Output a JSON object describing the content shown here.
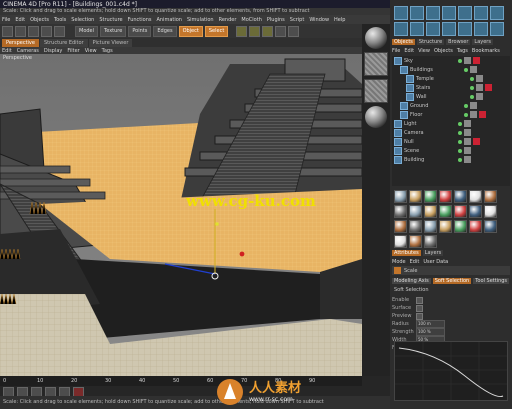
{
  "app": {
    "title": "CINEMA 4D [Pro R11] - [Buildings_001.c4d *]",
    "hint_top": "Scale: Click and drag to scale elements; hold down SHIFT to quantize scale; add to other elements, from SHIFT to subtract"
  },
  "menu": [
    "File",
    "Edit",
    "Objects",
    "Tools",
    "Selection",
    "Structure",
    "Functions",
    "Animation",
    "Simulation",
    "Render",
    "MoCloth",
    "Plugins",
    "Script",
    "Window",
    "Help"
  ],
  "toolbar": {
    "buttons": [
      "Model",
      "Texture",
      "Points",
      "Edges",
      "Object",
      "Select"
    ],
    "active": [
      "Object",
      "Select"
    ]
  },
  "view_tabs": [
    "Perspective",
    "Structure Editor",
    "Picture Viewer"
  ],
  "viewport": {
    "menu": [
      "Edit",
      "Cameras",
      "Display",
      "Filter",
      "View",
      "Tags"
    ],
    "label": "Perspective"
  },
  "timeline": {
    "frames": [
      "0",
      "10",
      "20",
      "30",
      "40",
      "50",
      "60",
      "70",
      "80",
      "90"
    ]
  },
  "helpbar": "Scale: Click and drag to scale elements; hold down SHIFT to quantize scale; add to other elements, hold down SHIFT to subtract",
  "objects_panel": {
    "tabs": [
      "Objects",
      "Structure",
      "Browser",
      "Layers"
    ],
    "menu": [
      "File",
      "Edit",
      "View",
      "Objects",
      "Tags",
      "Bookmarks"
    ],
    "items": [
      {
        "name": "Sky",
        "indent": 0
      },
      {
        "name": "Buildings",
        "indent": 1
      },
      {
        "name": "Temple",
        "indent": 2
      },
      {
        "name": "Stairs",
        "indent": 2
      },
      {
        "name": "Wall",
        "indent": 2
      },
      {
        "name": "Ground",
        "indent": 1
      },
      {
        "name": "Floor",
        "indent": 1
      },
      {
        "name": "Light",
        "indent": 0
      },
      {
        "name": "Camera",
        "indent": 0
      },
      {
        "name": "Null",
        "indent": 0
      },
      {
        "name": "Scene",
        "indent": 0
      },
      {
        "name": "Building",
        "indent": 0
      }
    ]
  },
  "materials_count": 24,
  "attributes_panel": {
    "tabs": [
      "Attributes",
      "Layers"
    ],
    "menu": [
      "Mode",
      "Edit",
      "User Data"
    ],
    "title": "Scale",
    "buttons": [
      "Modeling Axis",
      "Soft Selection",
      "Tool Settings"
    ],
    "active_button": "Soft Selection",
    "section": "Soft Selection",
    "rows": [
      {
        "key": "Enable",
        "value": ""
      },
      {
        "key": "Surface",
        "value": ""
      },
      {
        "key": "Preview",
        "value": ""
      },
      {
        "key": "Radius",
        "value": "100 m"
      },
      {
        "key": "Strength",
        "value": "100 %"
      },
      {
        "key": "Width",
        "value": "50 %"
      },
      {
        "key": "Falloff",
        "value": "Linear"
      }
    ]
  },
  "watermark": {
    "viewport": "www.cg-ku.com",
    "brand": "人人素材",
    "url": "www.rr-sc.com"
  }
}
